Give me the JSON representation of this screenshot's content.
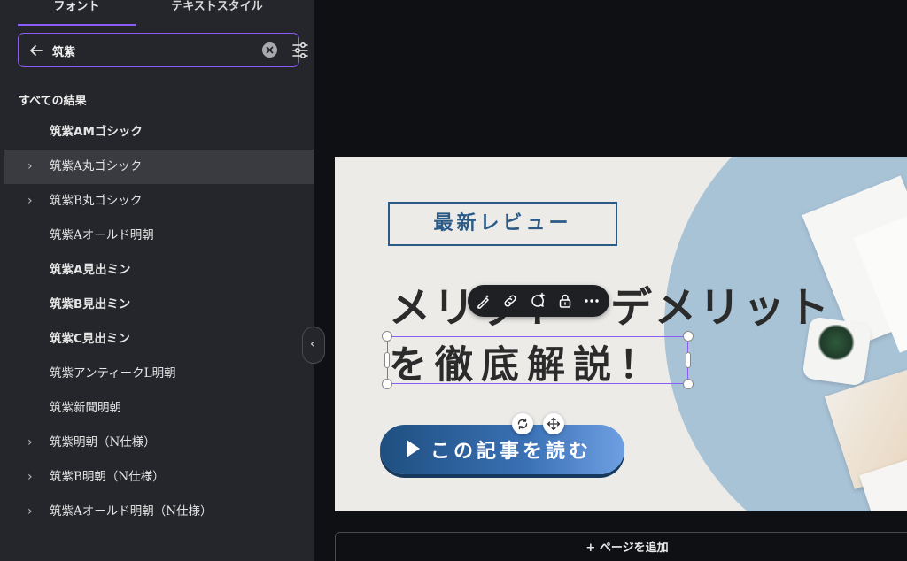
{
  "tabs": [
    {
      "label": "フォント"
    },
    {
      "label": "テキストスタイル"
    }
  ],
  "search": {
    "value": "筑紫",
    "placeholder": ""
  },
  "section_title": "すべての結果",
  "fonts": [
    {
      "label": "筑紫AMゴシック",
      "expandable": false,
      "bold": true
    },
    {
      "label": "筑紫A丸ゴシック",
      "expandable": true,
      "bold": false
    },
    {
      "label": "筑紫B丸ゴシック",
      "expandable": true,
      "bold": false
    },
    {
      "label": "筑紫Aオールド明朝",
      "expandable": false,
      "bold": false
    },
    {
      "label": "筑紫A見出ミン",
      "expandable": false,
      "bold": true
    },
    {
      "label": "筑紫B見出ミン",
      "expandable": false,
      "bold": true
    },
    {
      "label": "筑紫C見出ミン",
      "expandable": false,
      "bold": true
    },
    {
      "label": "筑紫アンティークL明朝",
      "expandable": false,
      "bold": false
    },
    {
      "label": "筑紫新聞明朝",
      "expandable": false,
      "bold": false
    },
    {
      "label": "筑紫明朝（N仕様）",
      "expandable": true,
      "bold": false
    },
    {
      "label": "筑紫B明朝（N仕様）",
      "expandable": true,
      "bold": false
    },
    {
      "label": "筑紫Aオールド明朝（N仕様）",
      "expandable": true,
      "bold": false
    }
  ],
  "design": {
    "badge": "最新レビュー",
    "headline_line1": "メリット・デメリット",
    "headline_line2": "を徹底解説！",
    "cta_label": "この記事を読む"
  },
  "add_page_label": "+ ページを追加",
  "colors": {
    "accent": "#8b5cf6",
    "panel_bg": "#25262b",
    "badge_blue": "#2c5a86",
    "cta_start": "#1f4f80",
    "cta_end": "#6f9fe3"
  }
}
